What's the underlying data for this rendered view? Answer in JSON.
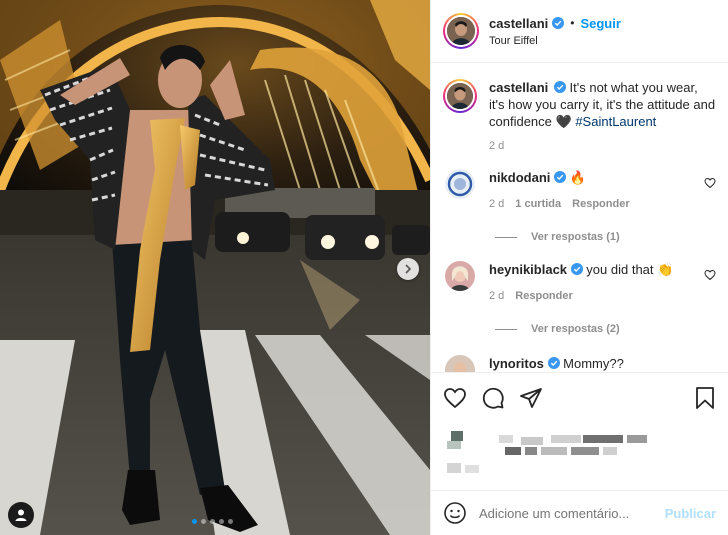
{
  "post": {
    "author": {
      "username": "castellani",
      "verified": true,
      "follow_label": "Seguir",
      "location": "Tour Eiffel"
    },
    "caption": {
      "username": "castellani",
      "text": "It's not what you wear, it's how you carry it, it's the attitude and confidence",
      "emoji": "🖤",
      "hashtag": "#SaintLaurent",
      "time": "2 d"
    },
    "comments": [
      {
        "username": "nikdodani",
        "verified": true,
        "text": "🔥",
        "time": "2 d",
        "likes": "1 curtida",
        "reply_label": "Responder",
        "view_replies": "Ver respostas (1)"
      },
      {
        "username": "heynikiblack",
        "verified": true,
        "text": "you did that 👏",
        "time": "2 d",
        "reply_label": "Responder",
        "view_replies": "Ver respostas (2)"
      },
      {
        "username": "lynoritos",
        "verified": true,
        "text": "Mommy??"
      }
    ],
    "carousel": {
      "count": 5,
      "active": 0
    },
    "add_comment": {
      "placeholder": "Adicione um comentário...",
      "publish_label": "Publicar"
    },
    "colors": {
      "accent": "#0095f6",
      "verified": "#3897f0",
      "hashtag": "#00376b",
      "muted": "#8e8e8e",
      "publish_disabled": "#b2dffc"
    },
    "icons": {
      "like": "heart-icon",
      "comment": "comment-icon",
      "share": "paper-plane-icon",
      "save": "bookmark-icon",
      "emoji": "smiley-icon",
      "next": "chevron-right-icon",
      "tags": "user-tag-icon"
    }
  }
}
